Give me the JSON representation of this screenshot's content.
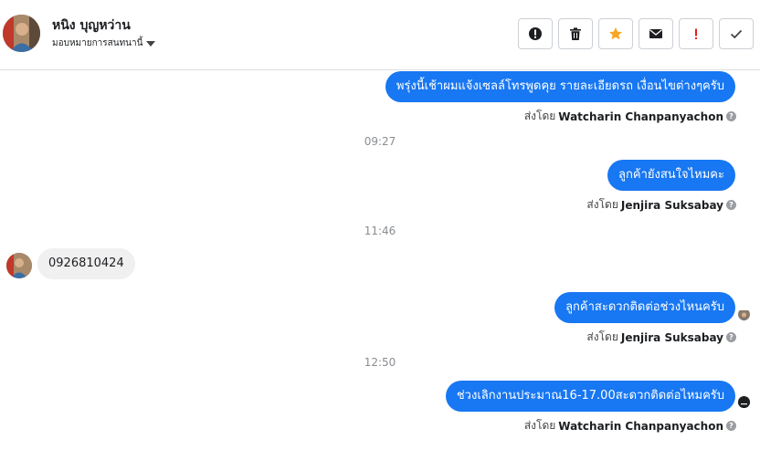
{
  "header": {
    "contact_name": "หนิง บุญหว่าน",
    "assign_label": "มอบหมายการสนทนานี้",
    "actions": [
      {
        "icon": "exclamation-circle-icon"
      },
      {
        "icon": "trash-icon"
      },
      {
        "icon": "star-icon",
        "color": "#f5a623"
      },
      {
        "icon": "envelope-icon"
      },
      {
        "icon": "exclamation-icon",
        "color": "#e02020"
      },
      {
        "icon": "checkmark-icon"
      }
    ]
  },
  "messages": {
    "m1_text": "พรุ่งนี้เช้าผมแจ้งเซลล์โทรพูดคุย รายละเอียดรถ เงื่อนไขต่างๆครับ",
    "m1_sent_prefix": "ส่งโดย",
    "m1_sender": "Watcharin Chanpanyachon",
    "t1": "09:27",
    "m2_text": "ลูกค้ายังสนใจไหมคะ",
    "m2_sent_prefix": "ส่งโดย",
    "m2_sender": "Jenjira Suksabay",
    "t2": "11:46",
    "m3_text": "0926810424",
    "m4_text": "ลูกค้าสะดวกติดต่อช่วงไหนครับ",
    "m4_sent_prefix": "ส่งโดย",
    "m4_sender": "Jenjira Suksabay",
    "t3": "12:50",
    "m5_text": "ช่วงเลิกงานประมาณ16-17.00สะดวกติดต่อไหมครับ",
    "m5_sent_prefix": "ส่งโดย",
    "m5_sender": "Watcharin Chanpanyachon"
  },
  "colors": {
    "outgoing_bubble": "#1877f2",
    "incoming_bubble": "#f0f0f0"
  }
}
